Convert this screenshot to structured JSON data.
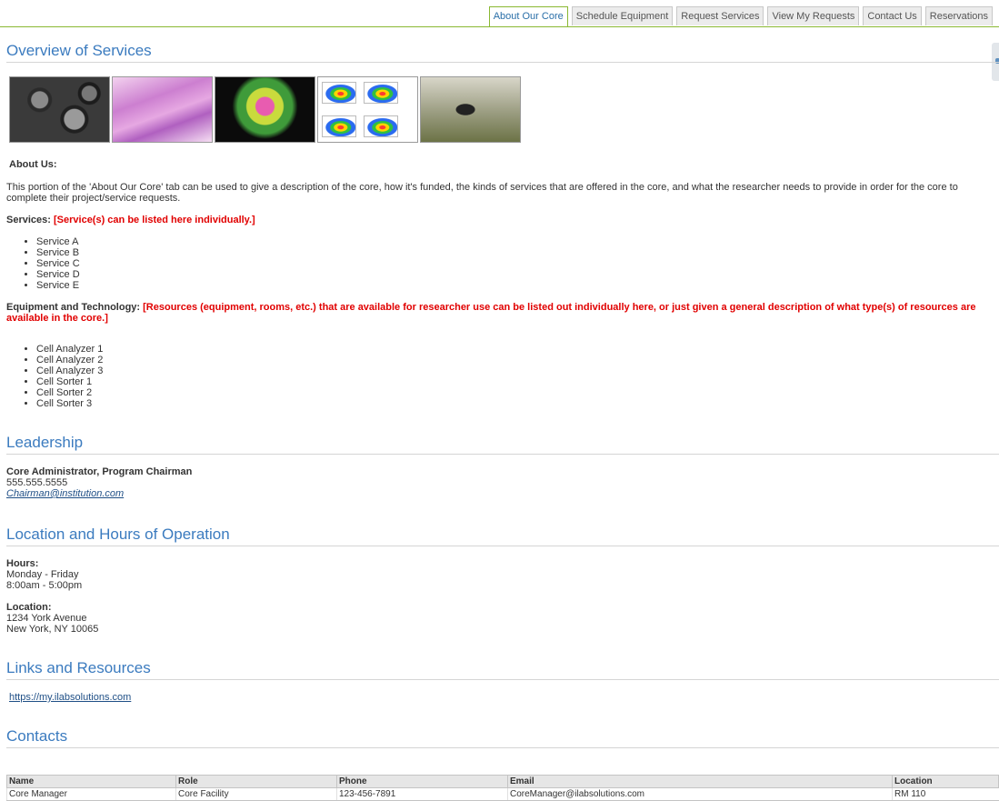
{
  "tabs": [
    {
      "label": "About Our Core",
      "active": true
    },
    {
      "label": "Schedule Equipment"
    },
    {
      "label": "Request Services"
    },
    {
      "label": "View My Requests"
    },
    {
      "label": "Contact Us"
    },
    {
      "label": "Reservations"
    }
  ],
  "overview": {
    "title": "Overview of Services",
    "images": [
      "cell-micrograph-image",
      "tissue-histology-image",
      "fluorescent-cell-image",
      "flow-cytometry-plot-image",
      "insect-macro-image"
    ],
    "about_label": "About Us:",
    "about_text": "This portion of the 'About Our Core' tab can be used to give a description of the core, how it's funded, the kinds of services that are offered in the core, and what the researcher needs to provide in order for the core to complete their project/service requests.",
    "services_label": "Services:",
    "services_note": "[Service(s) can be listed here individually.]",
    "services": [
      "Service A",
      "Service B",
      "Service C",
      "Service D",
      "Service E"
    ],
    "equipment_label": "Equipment and Technology:",
    "equipment_note": "[Resources (equipment, rooms, etc.) that are available for researcher use can be listed out individually here, or just given a general description of what type(s) of resources are available in the core.]",
    "equipment": [
      "Cell Analyzer 1",
      "Cell Analyzer 2",
      "Cell Analyzer 3",
      "Cell Sorter 1",
      "Cell Sorter 2",
      "Cell Sorter 3"
    ]
  },
  "leadership": {
    "title": "Leadership",
    "name": "Core Administrator, Program Chairman",
    "phone": "555.555.5555",
    "email": "Chairman@institution.com"
  },
  "location": {
    "title": "Location and Hours of Operation",
    "hours_label": "Hours:",
    "days": "Monday - Friday",
    "time": "8:00am - 5:00pm",
    "location_label": "Location:",
    "address1": "1234 York Avenue",
    "address2": "New York, NY 10065"
  },
  "links": {
    "title": "Links and Resources",
    "url": "https://my.ilabsolutions.com"
  },
  "contacts": {
    "title": "Contacts",
    "columns": [
      "Name",
      "Role",
      "Phone",
      "Email",
      "Location"
    ],
    "rows": [
      [
        "Core Manager",
        "Core Facility",
        "123-456-7891",
        "CoreManager@ilabsolutions.com",
        "RM 110"
      ]
    ]
  }
}
